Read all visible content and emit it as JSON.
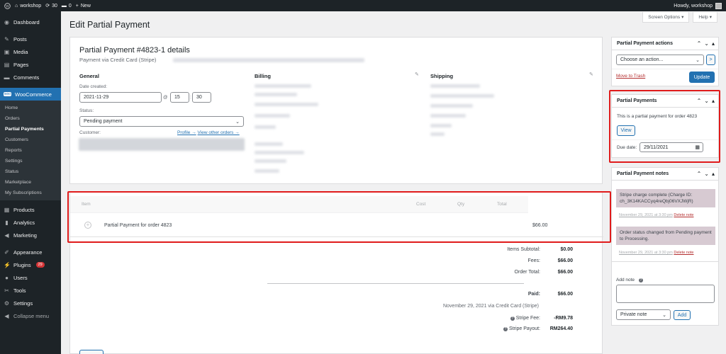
{
  "adminbar": {
    "site_name": "workshop",
    "updates": "30",
    "comments": "0",
    "new_label": "New",
    "greeting": "Howdy, workshop"
  },
  "sidebar": {
    "items_top": [
      {
        "label": "Dashboard",
        "icon": "dashboard-icon"
      },
      {
        "label": "Posts",
        "icon": "pin-icon"
      },
      {
        "label": "Media",
        "icon": "media-icon"
      },
      {
        "label": "Pages",
        "icon": "page-icon"
      },
      {
        "label": "Comments",
        "icon": "comment-icon"
      }
    ],
    "woocommerce": "WooCommerce",
    "woo_sub": [
      "Home",
      "Orders",
      "Partial Payments",
      "Customers",
      "Reports",
      "Settings",
      "Status",
      "Marketplace",
      "My Subscriptions"
    ],
    "items_mid": [
      {
        "label": "Products",
        "icon": "product-icon"
      },
      {
        "label": "Analytics",
        "icon": "chart-icon"
      },
      {
        "label": "Marketing",
        "icon": "megaphone-icon"
      }
    ],
    "items_bottom": [
      {
        "label": "Appearance",
        "icon": "brush-icon"
      },
      {
        "label": "Plugins",
        "icon": "plug-icon",
        "badge": "29"
      },
      {
        "label": "Users",
        "icon": "user-icon"
      },
      {
        "label": "Tools",
        "icon": "wrench-icon"
      },
      {
        "label": "Settings",
        "icon": "settings-icon"
      },
      {
        "label": "Collapse menu",
        "icon": "collapse-icon"
      }
    ]
  },
  "screen_options": "Screen Options",
  "help": "Help",
  "page_title": "Edit Partial Payment",
  "order": {
    "title": "Partial Payment #4823-1 details",
    "subtitle": "Payment via Credit Card (Stripe)",
    "general": "General",
    "billing": "Billing",
    "shipping": "Shipping",
    "date_created_label": "Date created:",
    "date": "2021-11-29",
    "at": "@",
    "hour": "15",
    "minute": "30",
    "status_label": "Status:",
    "status": "Pending payment",
    "customer_label": "Customer:",
    "profile_link": "Profile →",
    "other_orders_link": "View other orders →"
  },
  "items": {
    "headers": {
      "item": "Item",
      "cost": "Cost",
      "qty": "Qty",
      "total": "Total"
    },
    "row": {
      "name": "Partial Payment for order 4823",
      "total": "$66.00"
    },
    "totals": [
      {
        "label": "Items Subtotal:",
        "value": "$0.00"
      },
      {
        "label": "Fees:",
        "value": "$66.00"
      },
      {
        "label": "Order Total:",
        "value": "$66.00"
      }
    ],
    "paid_label": "Paid:",
    "paid_value": "$66.00",
    "paid_note": "November 29, 2021 via Credit Card (Stripe)",
    "stripe_fee_label": "Stripe Fee:",
    "stripe_fee": "-RM9.78",
    "stripe_payout_label": "Stripe Payout:",
    "stripe_payout": "RM264.40"
  },
  "actions_box": {
    "title": "Partial Payment actions",
    "select": "Choose an action...",
    "go": ">",
    "trash": "Move to Trash",
    "update": "Update"
  },
  "partial_box": {
    "title": "Partial Payments",
    "text": "This is a partial payment for order 4823",
    "view": "View",
    "due_label": "Due date:",
    "due_date": "29/11/2021"
  },
  "notes_box": {
    "title": "Partial Payment notes",
    "notes": [
      {
        "text": "Stripe charge complete (Charge ID: ch_3K14KACCyq4reQbj06VXJWjR)",
        "meta": "November 29, 2021 at 3:30 pm",
        "delete": "Delete note"
      },
      {
        "text": "Order status changed from Pending payment to Processing.",
        "meta": "November 29, 2021 at 3:30 pm",
        "delete": "Delete note"
      }
    ],
    "add_note": "Add note",
    "note_type": "Private note",
    "add_btn": "Add"
  },
  "colors": {
    "admin_dark": "#1d2327",
    "accent": "#2271b1",
    "highlight": "#e01b1b",
    "note_bg": "#d7cad2"
  }
}
